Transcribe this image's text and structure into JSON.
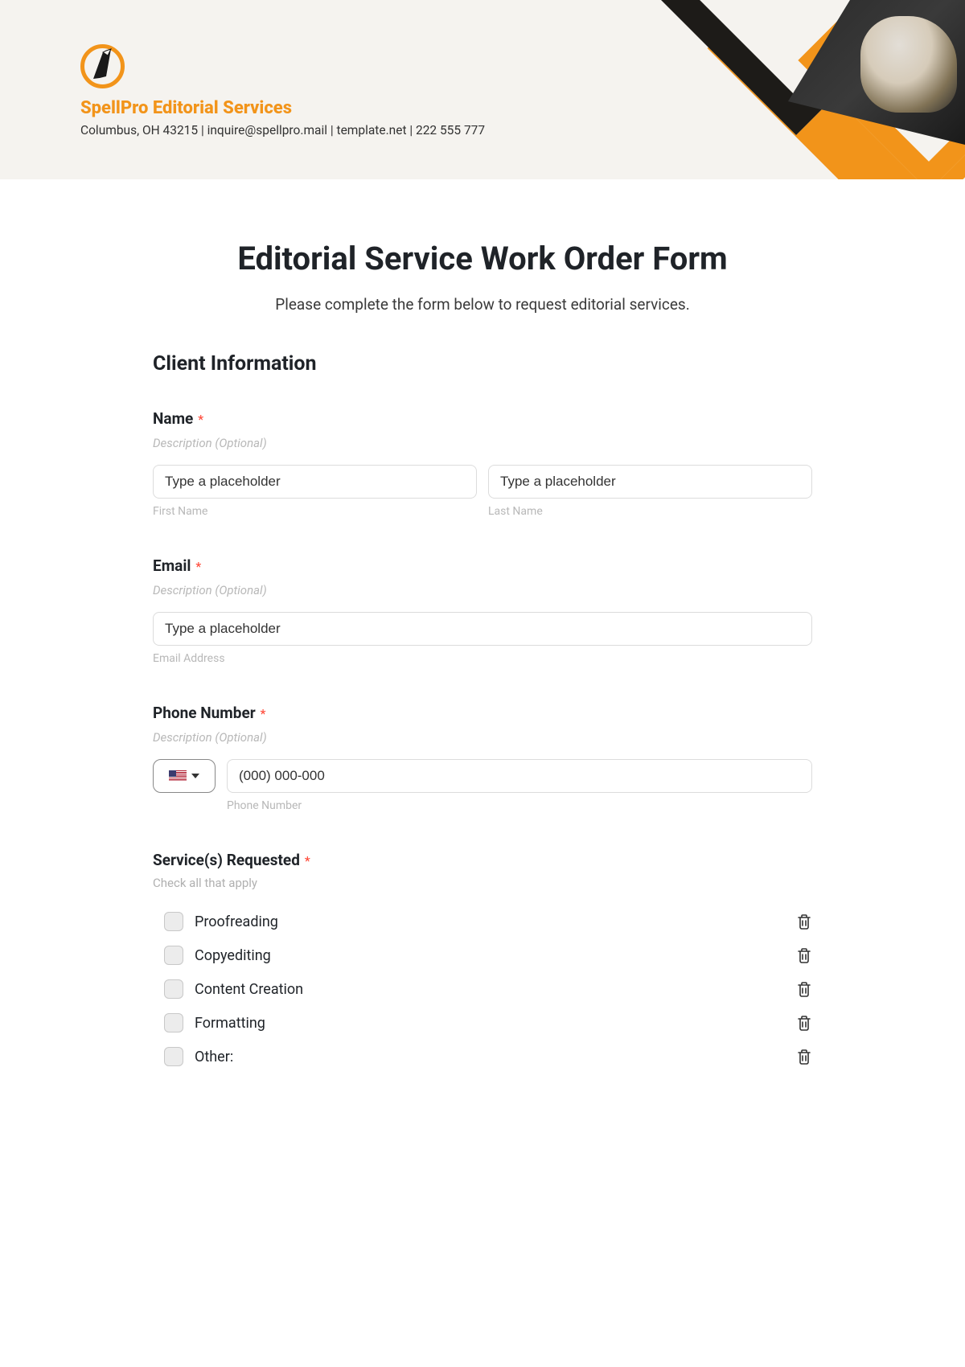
{
  "header": {
    "company_name": "SpellPro Editorial Services",
    "meta": "Columbus, OH 43215 | inquire@spellpro.mail | template.net | 222 555 777"
  },
  "form": {
    "title": "Editorial Service Work Order Form",
    "subtitle": "Please complete the form below to request editorial services.",
    "section_client": "Client Information",
    "required_mark": "*",
    "name": {
      "label": "Name",
      "desc": "Description (Optional)",
      "first_placeholder": "Type a placeholder",
      "last_placeholder": "Type a placeholder",
      "first_sub": "First Name",
      "last_sub": "Last Name"
    },
    "email": {
      "label": "Email",
      "desc": "Description (Optional)",
      "placeholder": "Type a placeholder",
      "sub": "Email Address"
    },
    "phone": {
      "label": "Phone Number",
      "desc": "Description (Optional)",
      "placeholder": "(000) 000-000",
      "sub": "Phone Number"
    },
    "services": {
      "label": "Service(s) Requested",
      "hint": "Check all that apply",
      "options": [
        "Proofreading",
        "Copyediting",
        "Content Creation",
        "Formatting",
        "Other:"
      ]
    }
  }
}
